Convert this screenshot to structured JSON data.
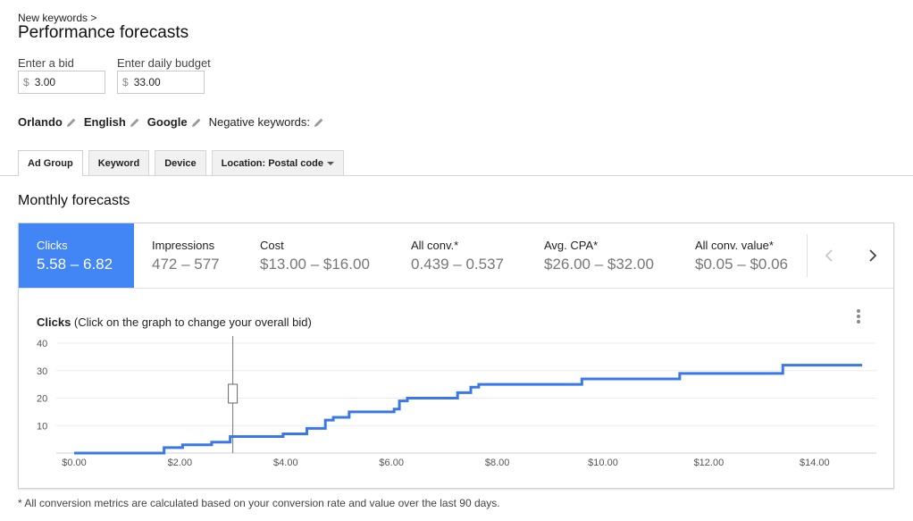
{
  "header": {
    "breadcrumb": "New keywords >",
    "title": "Performance forecasts"
  },
  "inputs": {
    "bid_label": "Enter a bid",
    "bid_currency": "$",
    "bid_value": "3.00",
    "budget_label": "Enter daily budget",
    "budget_currency": "$",
    "budget_value": "33.00"
  },
  "settings": {
    "location": "Orlando",
    "language": "English",
    "network": "Google",
    "negative_keywords_label": "Negative keywords:"
  },
  "tabs": [
    {
      "label": "Ad Group",
      "active": true
    },
    {
      "label": "Keyword",
      "active": false
    },
    {
      "label": "Device",
      "active": false
    },
    {
      "label": "Location: Postal code",
      "active": false,
      "dropdown": true
    }
  ],
  "section_title": "Monthly forecasts",
  "metrics": [
    {
      "label": "Clicks",
      "value": "5.58 – 6.82",
      "active": true
    },
    {
      "label": "Impressions",
      "value": "472 – 577"
    },
    {
      "label": "Cost",
      "value": "$13.00 – $16.00"
    },
    {
      "label": "All conv.*",
      "value": "0.439 – 0.537"
    },
    {
      "label": "Avg. CPA*",
      "value": "$26.00 – $32.00"
    },
    {
      "label": "All conv. value*",
      "value": "$0.05 – $0.06"
    }
  ],
  "chart": {
    "heading_bold": "Clicks",
    "heading_rest": " (Click on the graph to change your overall bid)"
  },
  "colors": {
    "accent": "#4285f4",
    "line": "#3b78e7"
  },
  "icons": {
    "edit": "pencil-icon",
    "prev": "chevron-left-icon",
    "next": "chevron-right-icon",
    "menu": "more-vert-icon"
  },
  "chart_data": {
    "type": "line",
    "step": true,
    "title": "Clicks",
    "subtitle": "(Click on the graph to change your overall bid)",
    "xlabel": "",
    "ylabel": "",
    "xlim": [
      0,
      15
    ],
    "ylim": [
      0,
      40
    ],
    "x_ticks": [
      "$0.00",
      "$2.00",
      "$4.00",
      "$6.00",
      "$8.00",
      "$10.00",
      "$12.00",
      "$14.00"
    ],
    "y_ticks": [
      "10",
      "20",
      "30",
      "40"
    ],
    "grid": true,
    "current_bid": 3.0,
    "series": [
      {
        "x": [
          0,
          1.7,
          2.05,
          2.6,
          2.95,
          3.7,
          3.95,
          4.4,
          4.75,
          4.9,
          5.2,
          6.05,
          6.15,
          6.3,
          7.25,
          7.5,
          7.65,
          9.6,
          11.45,
          13.4,
          14.9
        ],
        "y": [
          0,
          2,
          3,
          4,
          6,
          6,
          7,
          9,
          12,
          13,
          15,
          16,
          19,
          20,
          22,
          24,
          25,
          27,
          29,
          32,
          32
        ]
      }
    ]
  },
  "footnote": "* All conversion metrics are calculated based on your conversion rate and value over the last 90 days."
}
